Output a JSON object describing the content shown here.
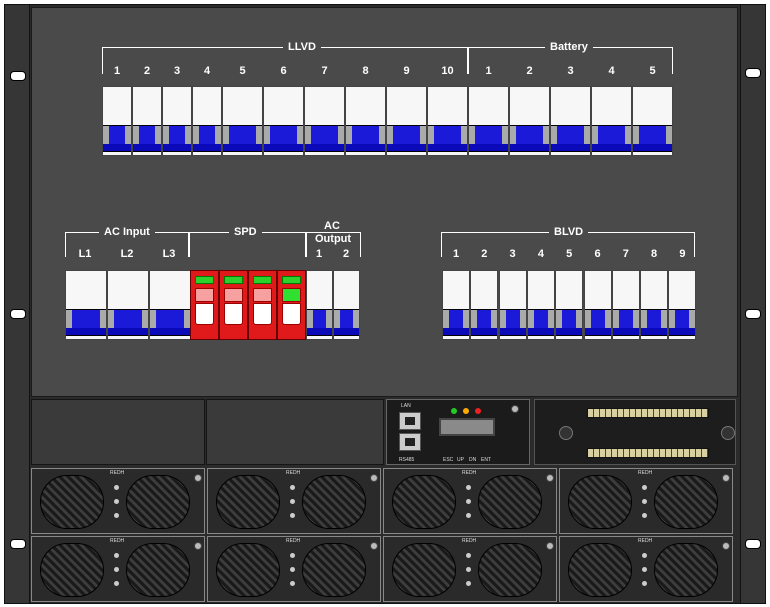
{
  "llvd_section": {
    "label": "LLVD",
    "positions": [
      "1",
      "2",
      "3",
      "4",
      "5",
      "6",
      "7",
      "8",
      "9",
      "10"
    ]
  },
  "battery_section": {
    "label": "Battery",
    "positions": [
      "1",
      "2",
      "3",
      "4",
      "5"
    ]
  },
  "ac_input_section": {
    "label": "AC Input",
    "positions": [
      "L1",
      "L2",
      "L3"
    ]
  },
  "spd_section": {
    "label": "SPD",
    "indicator_states": [
      "tripped",
      "tripped",
      "tripped",
      "ok"
    ]
  },
  "ac_output_section": {
    "label_line1": "AC",
    "label_line2": "Output",
    "positions": [
      "1",
      "2"
    ]
  },
  "blvd_section": {
    "label": "BLVD",
    "positions": [
      "1",
      "2",
      "3",
      "4",
      "5",
      "6",
      "7",
      "8",
      "9"
    ]
  },
  "controller": {
    "port_lan": "LAN",
    "port_rs485": "RS485",
    "keys": [
      "ESC",
      "UP",
      "DN",
      "ENT"
    ],
    "led_colors": [
      "#22cc22",
      "#ffaa00",
      "#ee2222"
    ]
  },
  "rectifiers": {
    "brand": "REDH",
    "count": 8
  },
  "colors": {
    "breaker_handle": "#1a1ad8",
    "spd_body": "#e01a1a",
    "spd_ok": "#30e030",
    "panel": "#4a4a4a"
  }
}
